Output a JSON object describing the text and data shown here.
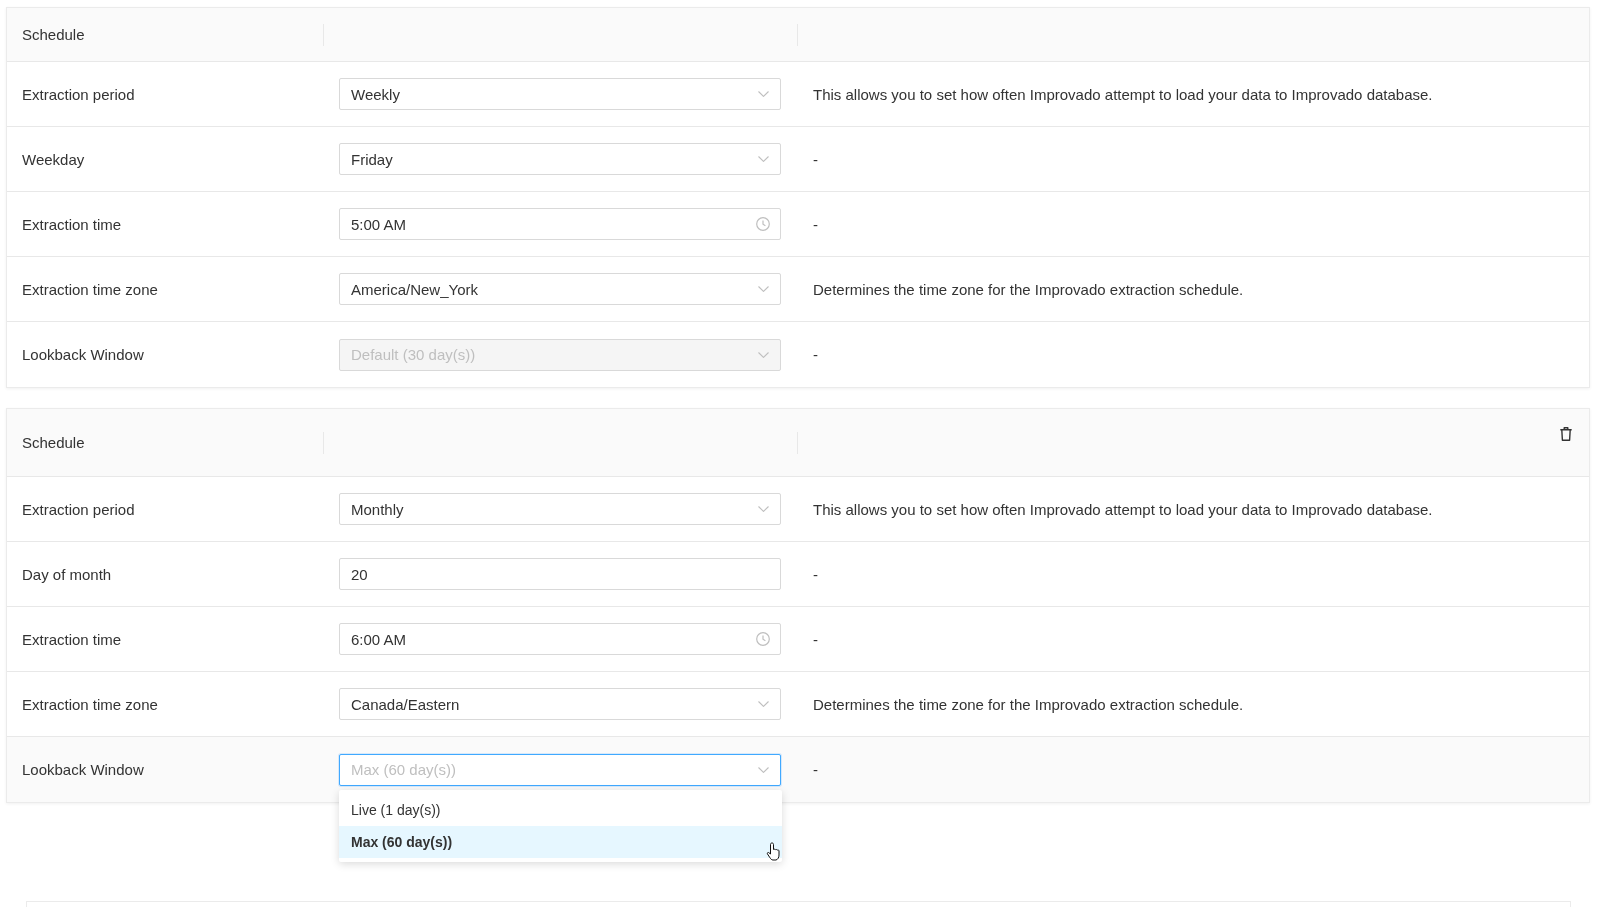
{
  "schedules": [
    {
      "title": "Schedule",
      "deletable": false,
      "fields": [
        {
          "label": "Extraction period",
          "kind": "select",
          "value": "Weekly",
          "disabled": false,
          "open": false,
          "description": "This allows you to set how often Improvado attempt to load your data to Improvado database."
        },
        {
          "label": "Weekday",
          "kind": "select",
          "value": "Friday",
          "disabled": false,
          "open": false,
          "description": "-"
        },
        {
          "label": "Extraction time",
          "kind": "time",
          "value": "5:00 AM",
          "disabled": false,
          "open": false,
          "description": "-"
        },
        {
          "label": "Extraction time zone",
          "kind": "select",
          "value": "America/New_York",
          "disabled": false,
          "open": false,
          "description": "Determines the time zone for the Improvado extraction schedule."
        },
        {
          "label": "Lookback Window",
          "kind": "select",
          "value": "Default (30 day(s))",
          "disabled": true,
          "open": false,
          "description": "-"
        }
      ]
    },
    {
      "title": "Schedule",
      "deletable": true,
      "fields": [
        {
          "label": "Extraction period",
          "kind": "select",
          "value": "Monthly",
          "disabled": false,
          "open": false,
          "description": "This allows you to set how often Improvado attempt to load your data to Improvado database."
        },
        {
          "label": "Day of month",
          "kind": "input",
          "value": "20",
          "disabled": false,
          "open": false,
          "description": "-"
        },
        {
          "label": "Extraction time",
          "kind": "time",
          "value": "6:00 AM",
          "disabled": false,
          "open": false,
          "description": "-"
        },
        {
          "label": "Extraction time zone",
          "kind": "select",
          "value": "Canada/Eastern",
          "disabled": false,
          "open": false,
          "description": "Determines the time zone for the Improvado extraction schedule."
        },
        {
          "label": "Lookback Window",
          "kind": "select",
          "value": "Max (60 day(s))",
          "disabled": false,
          "open": true,
          "description": "-",
          "options": [
            {
              "label": "Live (1 day(s))",
              "selected": false,
              "hovered": false
            },
            {
              "label": "Max (60 day(s))",
              "selected": true,
              "hovered": true
            }
          ]
        }
      ]
    }
  ]
}
